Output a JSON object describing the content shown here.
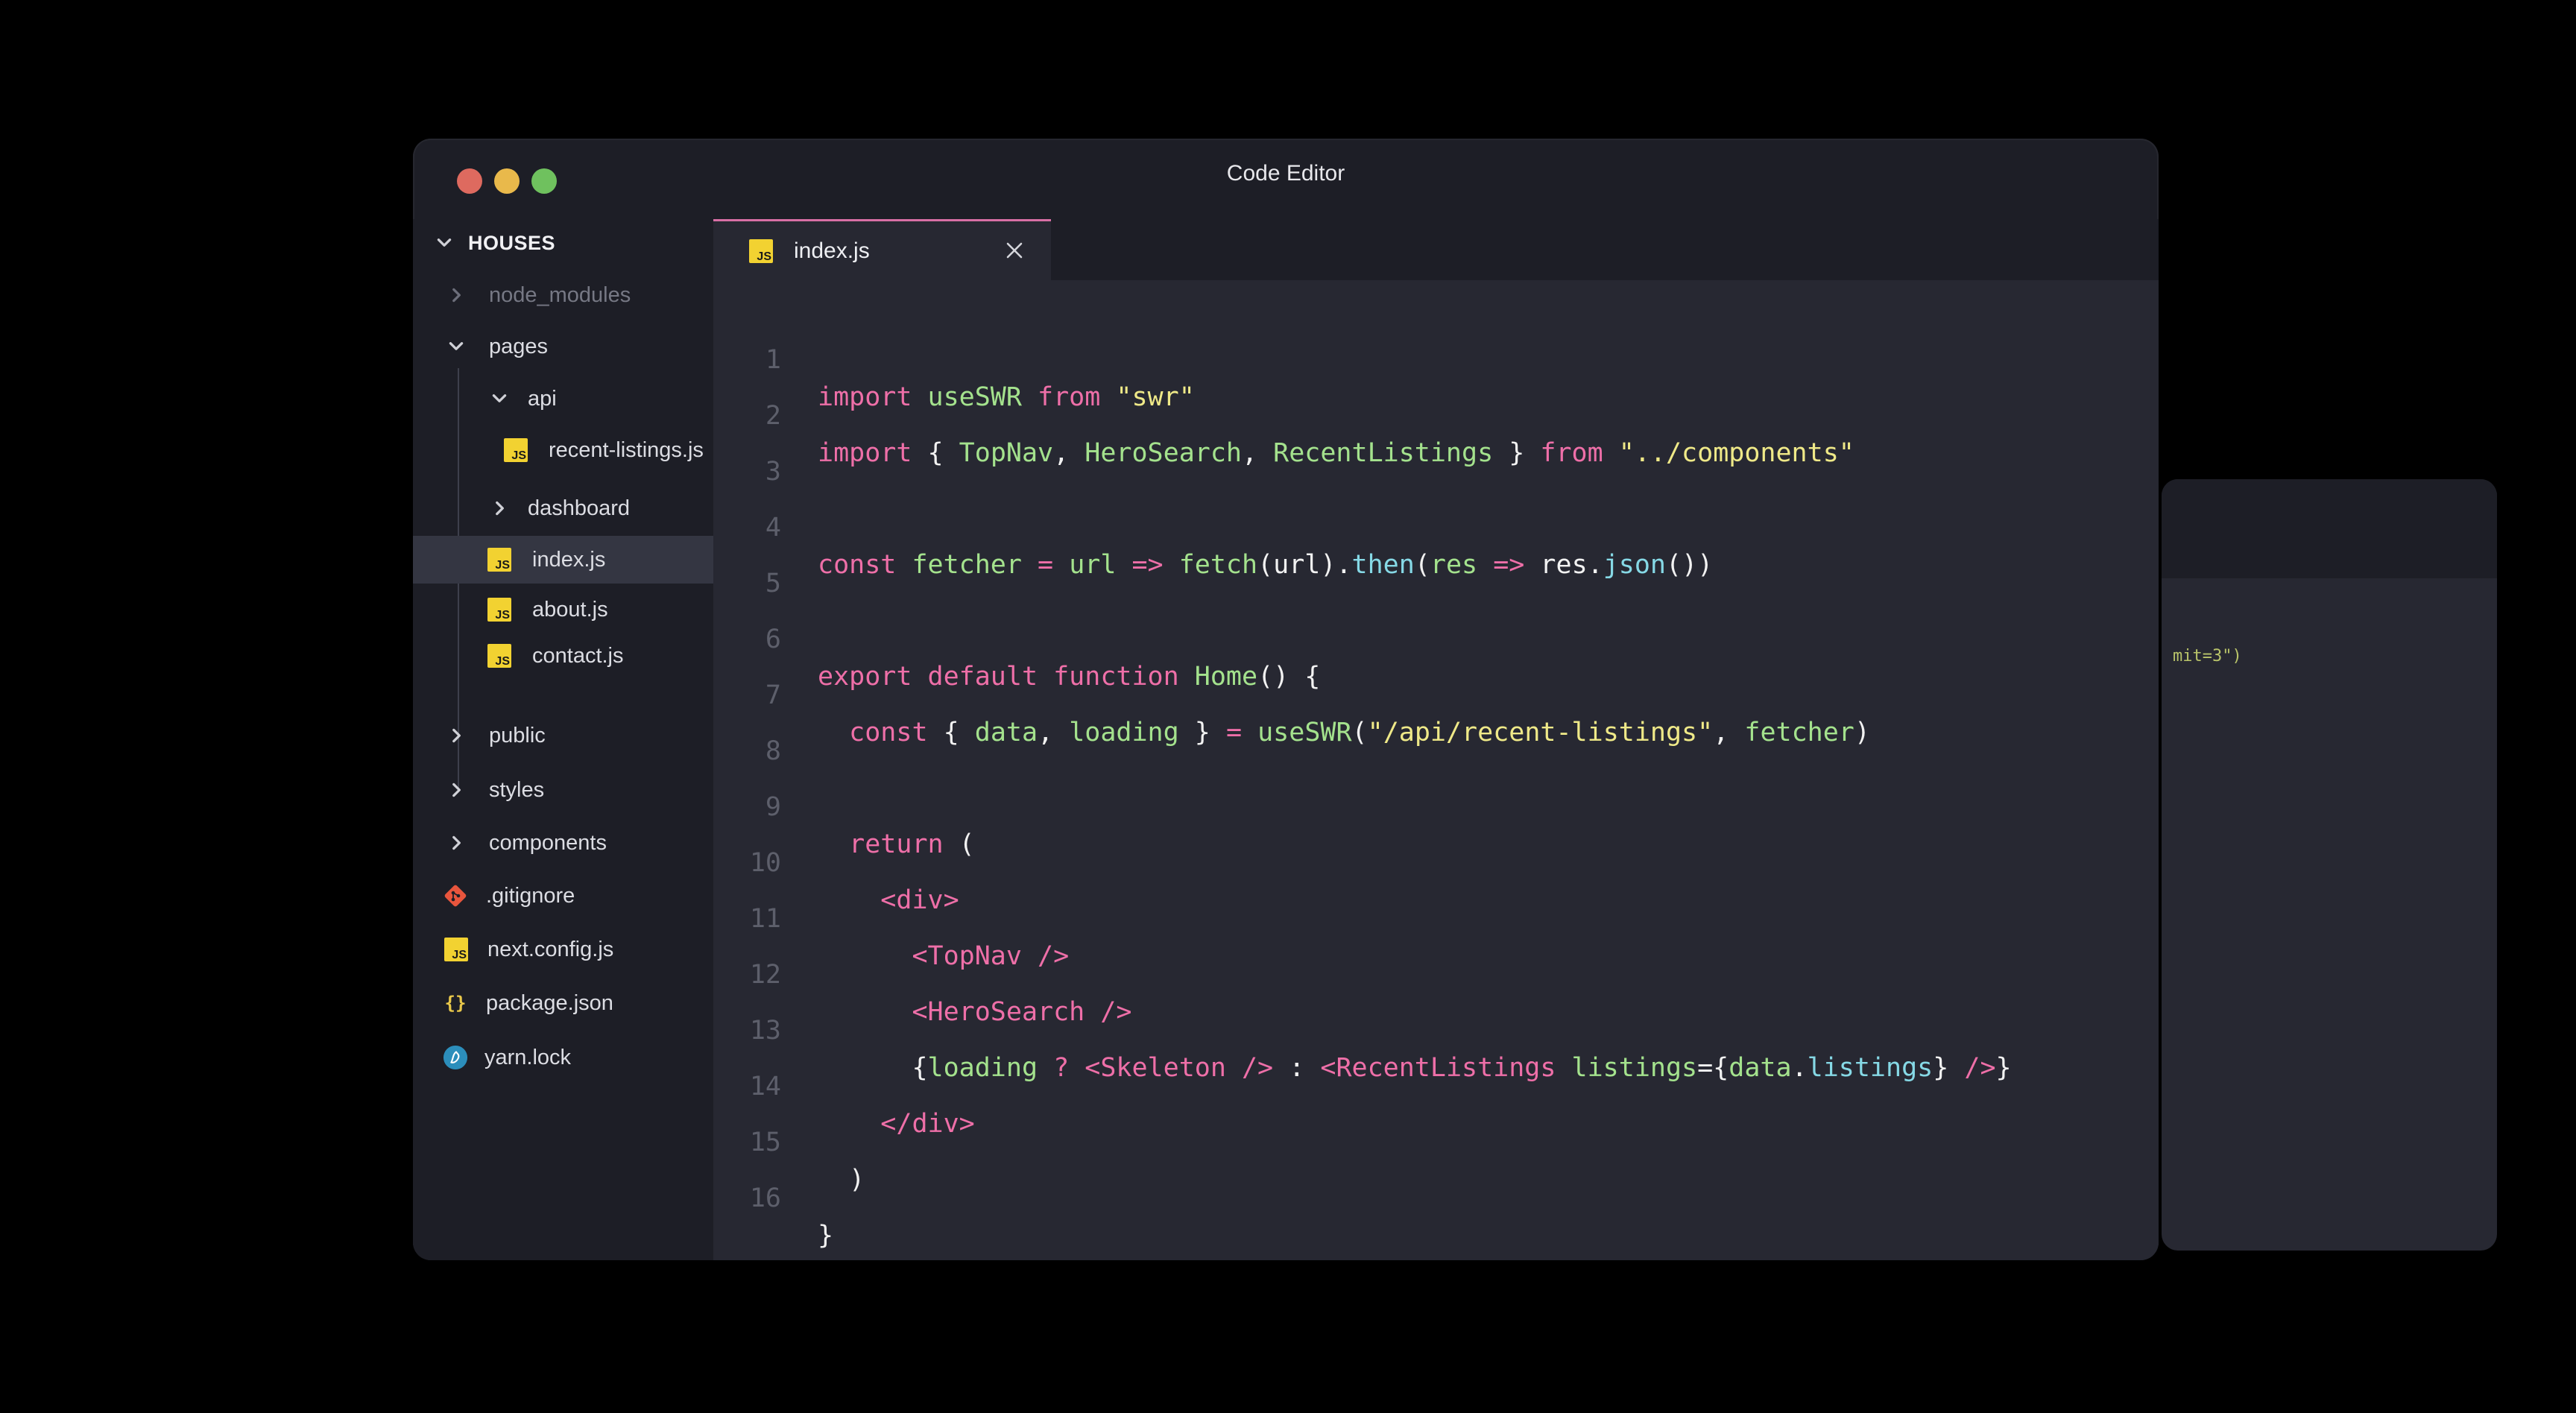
{
  "window": {
    "title": "Code Editor"
  },
  "background_window": {
    "code_fragment": "mit=3\")"
  },
  "sidebar": {
    "root": "HOUSES",
    "items": [
      {
        "label": "node_modules",
        "type": "folder",
        "state": "collapsed",
        "dim": true
      },
      {
        "label": "pages",
        "type": "folder",
        "state": "expanded"
      },
      {
        "label": "api",
        "type": "folder",
        "state": "expanded"
      },
      {
        "label": "recent-listings.js",
        "type": "js"
      },
      {
        "label": "dashboard",
        "type": "folder",
        "state": "collapsed"
      },
      {
        "label": "index.js",
        "type": "js",
        "active": true
      },
      {
        "label": "about.js",
        "type": "js"
      },
      {
        "label": "contact.js",
        "type": "js"
      },
      {
        "label": "public",
        "type": "folder",
        "state": "collapsed"
      },
      {
        "label": "styles",
        "type": "folder",
        "state": "collapsed"
      },
      {
        "label": "components",
        "type": "folder",
        "state": "collapsed"
      },
      {
        "label": ".gitignore",
        "type": "git"
      },
      {
        "label": "next.config.js",
        "type": "js"
      },
      {
        "label": "package.json",
        "type": "json"
      },
      {
        "label": "yarn.lock",
        "type": "yarn"
      }
    ]
  },
  "editor": {
    "tab": {
      "label": "index.js",
      "icon": "js-file-icon"
    },
    "line_numbers": [
      "1",
      "2",
      "3",
      "4",
      "5",
      "6",
      "7",
      "8",
      "9",
      "10",
      "11",
      "12",
      "13",
      "14",
      "15",
      "16"
    ],
    "code": {
      "l1": [
        "import",
        "useSWR",
        "from",
        "\"swr\""
      ],
      "l2": [
        "import",
        "{",
        "TopNav",
        ",",
        "HeroSearch",
        ",",
        "RecentListings",
        "}",
        "from",
        "\"../components\""
      ],
      "l4": [
        "const",
        "fetcher",
        "=",
        "url",
        "=>",
        "fetch",
        "(url).",
        "then",
        "(",
        "res",
        "=>",
        "res.",
        "json",
        "())"
      ],
      "l6": [
        "export",
        "default",
        "function",
        "Home",
        "() {"
      ],
      "l7": [
        "const",
        "{",
        "data",
        ",",
        "loading",
        "}",
        "=",
        "useSWR",
        "(",
        "\"/api/recent-listings\"",
        ",",
        "fetcher",
        ")"
      ],
      "l9": [
        "return",
        "("
      ],
      "l10": [
        "<div>"
      ],
      "l11": [
        "<TopNav />"
      ],
      "l12": [
        "<HeroSearch />"
      ],
      "l13": [
        "{",
        "loading",
        "?",
        "<Skeleton />",
        ":",
        "<RecentListings",
        "listings",
        "={",
        "data",
        ".",
        "listings",
        "}",
        "/>",
        "}"
      ],
      "l14": [
        "</div>"
      ],
      "l15": [
        ")"
      ],
      "l16": [
        "}"
      ]
    }
  },
  "colors": {
    "keyword": "#ee6fa8",
    "function": "#a4e28d",
    "string": "#efe988",
    "method": "#86d9e6",
    "accent_tab": "#d86fa5"
  }
}
